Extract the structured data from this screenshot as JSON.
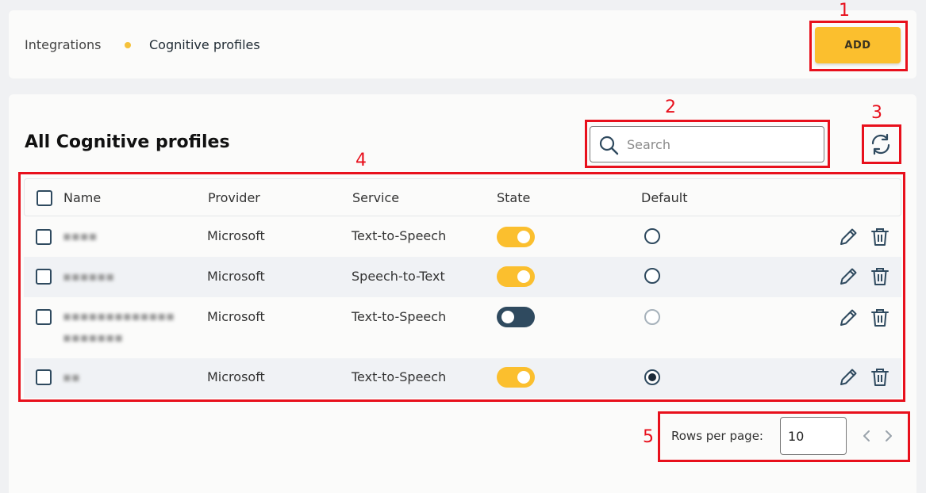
{
  "breadcrumb": {
    "items": [
      "Integrations",
      "Cognitive profiles"
    ]
  },
  "toolbar": {
    "add_label": "ADD"
  },
  "page": {
    "title": "All Cognitive profiles"
  },
  "search": {
    "placeholder": "Search",
    "value": ""
  },
  "table": {
    "columns": [
      "Name",
      "Provider",
      "Service",
      "State",
      "Default"
    ],
    "rows": [
      {
        "provider": "Microsoft",
        "service": "Text-to-Speech",
        "state_on": true,
        "default": "unchecked"
      },
      {
        "provider": "Microsoft",
        "service": "Speech-to-Text",
        "state_on": true,
        "default": "unchecked"
      },
      {
        "provider": "Microsoft",
        "service": "Text-to-Speech",
        "state_on": false,
        "default": "disabled"
      },
      {
        "provider": "Microsoft",
        "service": "Text-to-Speech",
        "state_on": true,
        "default": "checked"
      }
    ]
  },
  "pagination": {
    "rows_label": "Rows per page:",
    "rows_value": "10"
  },
  "annotations": [
    "1",
    "2",
    "3",
    "4",
    "5"
  ],
  "colors": {
    "accent": "#fbbf2e",
    "dark": "#2f4a5f",
    "annotation": "#e8101c"
  },
  "icons": [
    "search-icon",
    "refresh-icon",
    "edit-icon",
    "trash-icon",
    "chevron-left-icon",
    "chevron-right-icon"
  ]
}
